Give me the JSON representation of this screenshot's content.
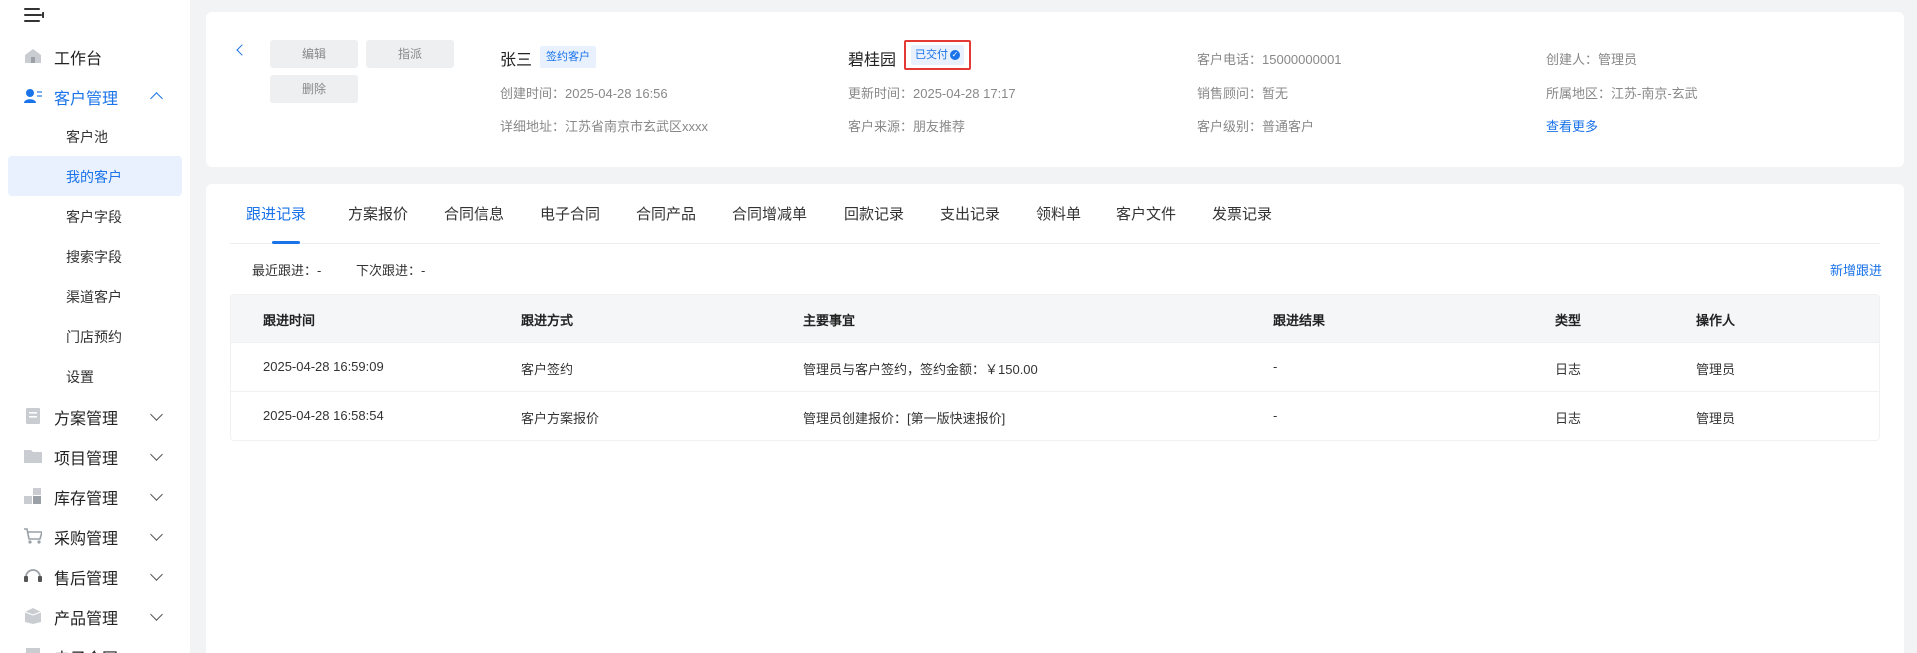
{
  "sidebar": {
    "groups_top": [
      {
        "label": "工作台",
        "icon": "home-icon"
      },
      {
        "label": "客户管理",
        "icon": "customer-icon"
      }
    ],
    "sub_items": [
      {
        "label": "客户池"
      },
      {
        "label": "我的客户"
      },
      {
        "label": "客户字段"
      },
      {
        "label": "搜索字段"
      },
      {
        "label": "渠道客户"
      },
      {
        "label": "门店预约"
      },
      {
        "label": "设置"
      }
    ],
    "groups_bottom": [
      {
        "label": "方案管理",
        "icon": "document-icon"
      },
      {
        "label": "项目管理",
        "icon": "folder-icon"
      },
      {
        "label": "库存管理",
        "icon": "inventory-icon"
      },
      {
        "label": "采购管理",
        "icon": "cart-icon"
      },
      {
        "label": "售后管理",
        "icon": "headset-icon"
      },
      {
        "label": "产品管理",
        "icon": "box-icon"
      },
      {
        "label": "电子合同",
        "icon": "contract-icon"
      }
    ]
  },
  "header": {
    "buttons": {
      "edit": "编辑",
      "assign": "指派",
      "delete": "删除"
    },
    "customer_name": "张三",
    "customer_tag": "签约客户",
    "project_name": "碧桂园",
    "status_tag": "已交付",
    "fields": {
      "created_time": "创建时间：2025-04-28 16:56",
      "address": "详细地址：江苏省南京市玄武区xxxx",
      "updated_time": "更新时间：2025-04-28 17:17",
      "source": "客户来源：朋友推荐",
      "phone": "客户电话：15000000001",
      "sales": "销售顾问：暂无",
      "level": "客户级别：普通客户",
      "creator": "创建人：管理员",
      "region": "所属地区：江苏-南京-玄武"
    },
    "more": "查看更多"
  },
  "tabs": [
    "跟进记录",
    "方案报价",
    "合同信息",
    "电子合同",
    "合同产品",
    "合同增减单",
    "回款记录",
    "支出记录",
    "领料单",
    "客户文件",
    "发票记录"
  ],
  "follow": {
    "recent": "最近跟进：-",
    "next": "下次跟进：-",
    "add": "新增跟进"
  },
  "table": {
    "headers": [
      "跟进时间",
      "跟进方式",
      "主要事宜",
      "跟进结果",
      "类型",
      "操作人"
    ],
    "rows": [
      [
        "2025-04-28 16:59:09",
        "客户签约",
        "管理员与客户签约，签约金额：￥150.00",
        "-",
        "日志",
        "管理员"
      ],
      [
        "2025-04-28 16:58:54",
        "客户方案报价",
        "管理员创建报价：[第一版快速报价]",
        "-",
        "日志",
        "管理员"
      ]
    ]
  },
  "colors": {
    "accent": "#1a73e8",
    "highlight": "#e53935",
    "page_bg": "#f2f3f5"
  }
}
